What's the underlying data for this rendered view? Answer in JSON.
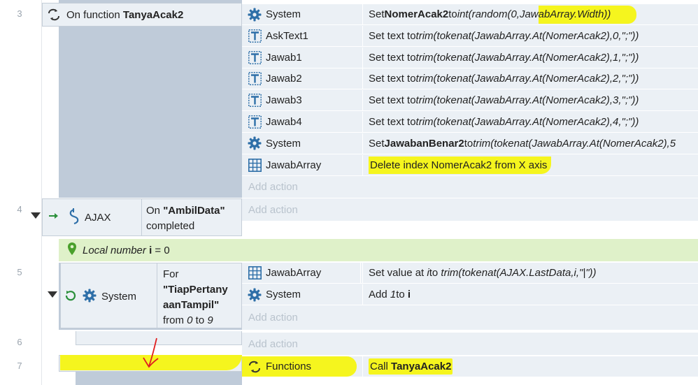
{
  "rows": [
    {
      "num": "3"
    },
    {
      "num": "4"
    },
    {
      "num": "5"
    },
    {
      "num": "6"
    },
    {
      "num": "7"
    }
  ],
  "ev3": {
    "trigger_prefix": "On function ",
    "trigger_name": "TanyaAcak2",
    "actions": [
      {
        "obj": "System",
        "icon": "gear-icon",
        "pre": "Set ",
        "bold": "NomerAcak2",
        "mid": " to ",
        "ital": "int(random(0,JawabArray.Width))",
        "post": ""
      },
      {
        "obj": "AskText1",
        "icon": "text-icon",
        "pre": "Set text to ",
        "bold": "",
        "mid": "",
        "ital": "trim(tokenat(JawabArray.At(NomerAcak2),0,\";\"))",
        "post": ""
      },
      {
        "obj": "Jawab1",
        "icon": "text-icon",
        "pre": "Set text to ",
        "bold": "",
        "mid": "",
        "ital": "trim(tokenat(JawabArray.At(NomerAcak2),1,\";\"))",
        "post": ""
      },
      {
        "obj": "Jawab2",
        "icon": "text-icon",
        "pre": "Set text to ",
        "bold": "",
        "mid": "",
        "ital": "trim(tokenat(JawabArray.At(NomerAcak2),2,\";\"))",
        "post": ""
      },
      {
        "obj": "Jawab3",
        "icon": "text-icon",
        "pre": "Set text to ",
        "bold": "",
        "mid": "",
        "ital": "trim(tokenat(JawabArray.At(NomerAcak2),3,\";\"))",
        "post": ""
      },
      {
        "obj": "Jawab4",
        "icon": "text-icon",
        "pre": "Set text to ",
        "bold": "",
        "mid": "",
        "ital": "trim(tokenat(JawabArray.At(NomerAcak2),4,\";\"))",
        "post": ""
      },
      {
        "obj": "System",
        "icon": "gear-icon",
        "pre": "Set ",
        "bold": "JawabanBenar2",
        "mid": " to ",
        "ital": "trim(tokenat(JawabArray.At(NomerAcak2),5",
        "post": ""
      },
      {
        "obj": "JawabArray",
        "icon": "array-icon",
        "pre": "Delete index NomerAcak2 from X axis",
        "bold": "",
        "mid": "",
        "ital": "",
        "post": ""
      }
    ],
    "add_action": "Add action"
  },
  "ev4": {
    "object": "AJAX",
    "trig_pre": "On ",
    "trig_name": "\"AmbilData\"",
    "trig_post": "completed",
    "add_action": "Add action"
  },
  "local_var": {
    "pre": "Local number ",
    "name": "i",
    "post": " = 0"
  },
  "ev5": {
    "object": "System",
    "for_label": "For",
    "for_name_1": "\"TiapPertany",
    "for_name_2": "aanTampil\"",
    "from_pre": "from ",
    "from_a": "0",
    "from_mid": " to ",
    "from_b": "9",
    "actions": [
      {
        "obj": "JawabArray",
        "pre": "Set value at ",
        "ital1": "i",
        "mid": " to ",
        "ital2": "trim(tokenat(AJAX.LastData,i,\"|\"))"
      },
      {
        "obj": "System",
        "pre": "Add ",
        "ital1": "1",
        "mid": " to ",
        "bold": "i"
      }
    ],
    "add_action": "Add action"
  },
  "ev6": {
    "add_action": "Add action"
  },
  "ev7": {
    "obj": "Functions",
    "pre": "Call ",
    "bold": "TanyaAcak2"
  },
  "colors": {
    "event_bg": "#bfcbd9",
    "action_bg": "#ebf0f5",
    "local_var_bg": "#dff1c9",
    "highlight": "#f5f51e",
    "annotation": "#e02020"
  }
}
